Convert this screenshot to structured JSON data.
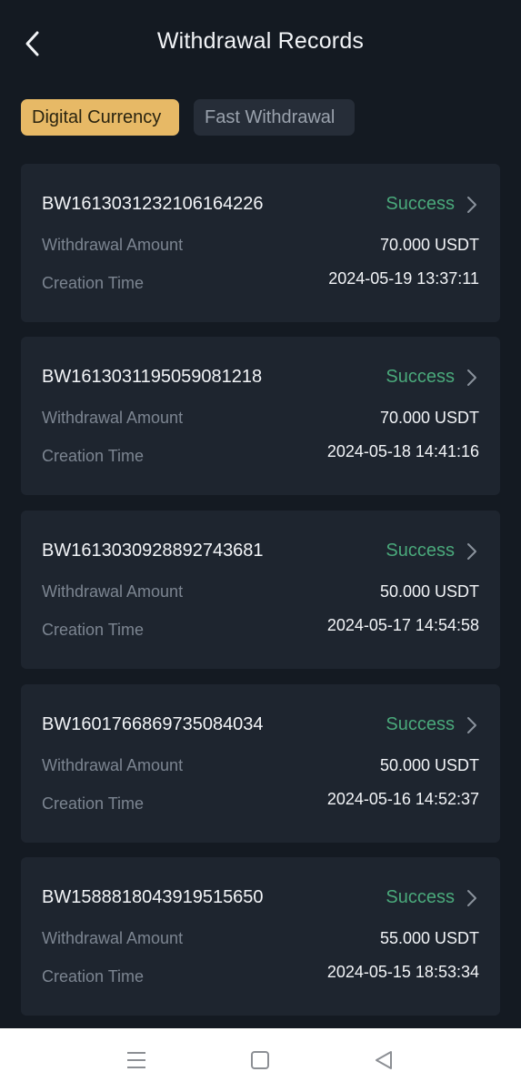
{
  "header": {
    "title": "Withdrawal Records"
  },
  "tabs": [
    {
      "label": "Digital Currency",
      "active": true
    },
    {
      "label": "Fast Withdrawal",
      "active": false
    }
  ],
  "labels": {
    "amount": "Withdrawal Amount",
    "time": "Creation Time"
  },
  "records": [
    {
      "id": "BW1613031232106164226",
      "status": "Success",
      "amount": "70.000 USDT",
      "time": "2024-05-19 13:37:11"
    },
    {
      "id": "BW1613031195059081218",
      "status": "Success",
      "amount": "70.000 USDT",
      "time": "2024-05-18 14:41:16"
    },
    {
      "id": "BW1613030928892743681",
      "status": "Success",
      "amount": "50.000 USDT",
      "time": "2024-05-17 14:54:58"
    },
    {
      "id": "BW1601766869735084034",
      "status": "Success",
      "amount": "50.000 USDT",
      "time": "2024-05-16 14:52:37"
    },
    {
      "id": "BW1588818043919515650",
      "status": "Success",
      "amount": "55.000 USDT",
      "time": "2024-05-15 18:53:34"
    }
  ],
  "colors": {
    "background": "#141a22",
    "card": "#1e252f",
    "accent": "#e7b966",
    "success": "#4aa97b"
  },
  "icons": {
    "back": "chevron-left-icon",
    "row_arrow": "chevron-right-icon",
    "nav": [
      "menu-icon",
      "home-square-icon",
      "back-triangle-icon"
    ]
  }
}
